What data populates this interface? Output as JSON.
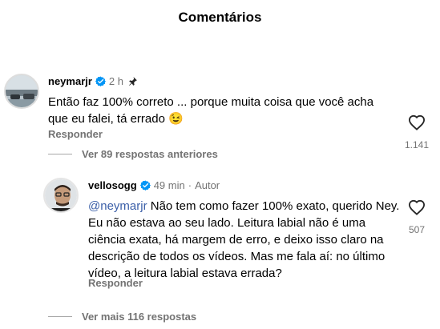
{
  "header": {
    "title": "Comentários"
  },
  "comments": [
    {
      "username": "neymarjr",
      "time": "2 h",
      "text": "Então faz 100% correto ... porque muita coisa que você acha que eu falei, tá errado 😉",
      "reply_label": "Responder",
      "likes": "1.141"
    }
  ],
  "thread": {
    "view_previous": "Ver 89 respostas anteriores"
  },
  "reply": {
    "username": "vellosogg",
    "time": "49 min",
    "separator": "·",
    "author_label": "Autor",
    "mention": "@neymarjr",
    "text": " Não tem como fazer 100% exato, querido Ney. Eu não estava ao seu lado. Leitura labial não é uma ciência exata, há margem de erro, e deixo isso claro na descrição de todos os vídeos. Mas me fala aí: no último vídeo, a leitura labial estava errada?",
    "reply_label": "Responder",
    "likes": "507"
  },
  "footer": {
    "view_more": "Ver mais 116 respostas"
  },
  "colors": {
    "verified": "#0095f6",
    "mention": "#3b5fa8",
    "muted": "#737373"
  }
}
